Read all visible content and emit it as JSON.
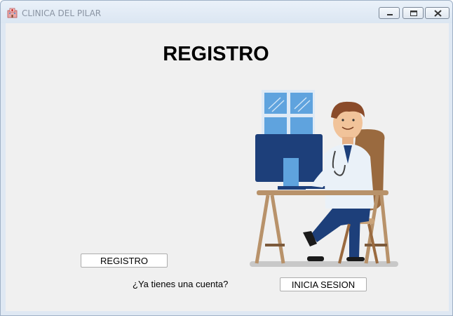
{
  "window": {
    "title": "CLINICA DEL PILAR",
    "icon": "hospital-icon",
    "controls": [
      "minimize-icon",
      "maximize-icon",
      "close-icon"
    ]
  },
  "main": {
    "heading": "REGISTRO",
    "register_button_label": "REGISTRO",
    "account_prompt": "¿Ya tienes una cuenta?",
    "login_button_label": "INICIA SESION",
    "illustration": "doctor-at-computer"
  }
}
